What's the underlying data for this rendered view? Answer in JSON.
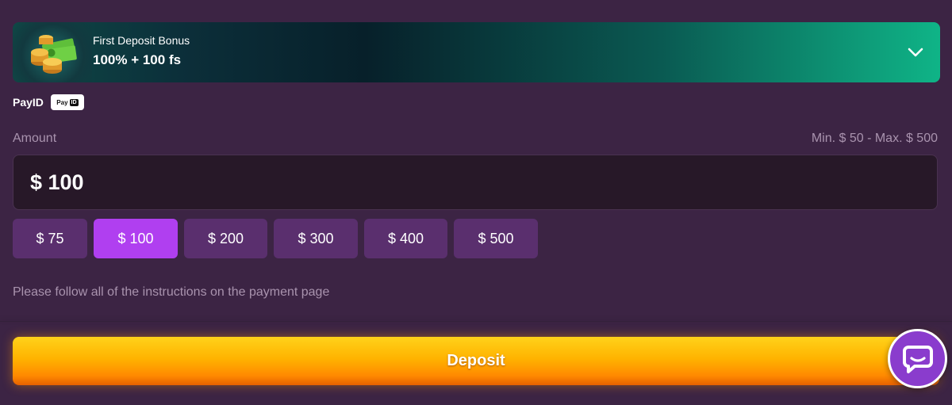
{
  "bonus": {
    "label": "First Deposit Bonus",
    "value": "100% + 100 fs"
  },
  "method": {
    "name": "PayID",
    "badge_left": "Pay",
    "badge_right": "ID"
  },
  "amount": {
    "label": "Amount",
    "limits": "Min. $ 50 - Max. $ 500",
    "value": "$ 100"
  },
  "quick_amounts": [
    {
      "label": "$ 75",
      "selected": false
    },
    {
      "label": "$ 100",
      "selected": true
    },
    {
      "label": "$ 200",
      "selected": false
    },
    {
      "label": "$ 300",
      "selected": false
    },
    {
      "label": "$ 400",
      "selected": false
    },
    {
      "label": "$ 500",
      "selected": false
    }
  ],
  "note": "Please follow all of the instructions on the payment page",
  "deposit_label": "Deposit",
  "icons": {
    "bonus": "money-stack-icon",
    "expand": "chevron-down-icon",
    "chat": "chat-bubble-icon"
  },
  "colors": {
    "background": "#3c2444",
    "chip": "#5a2f6e",
    "chip_active": "#b03ff0",
    "deposit": "#ffb300",
    "chat": "#8a3ccd",
    "bonus_accent": "#0fb487"
  }
}
